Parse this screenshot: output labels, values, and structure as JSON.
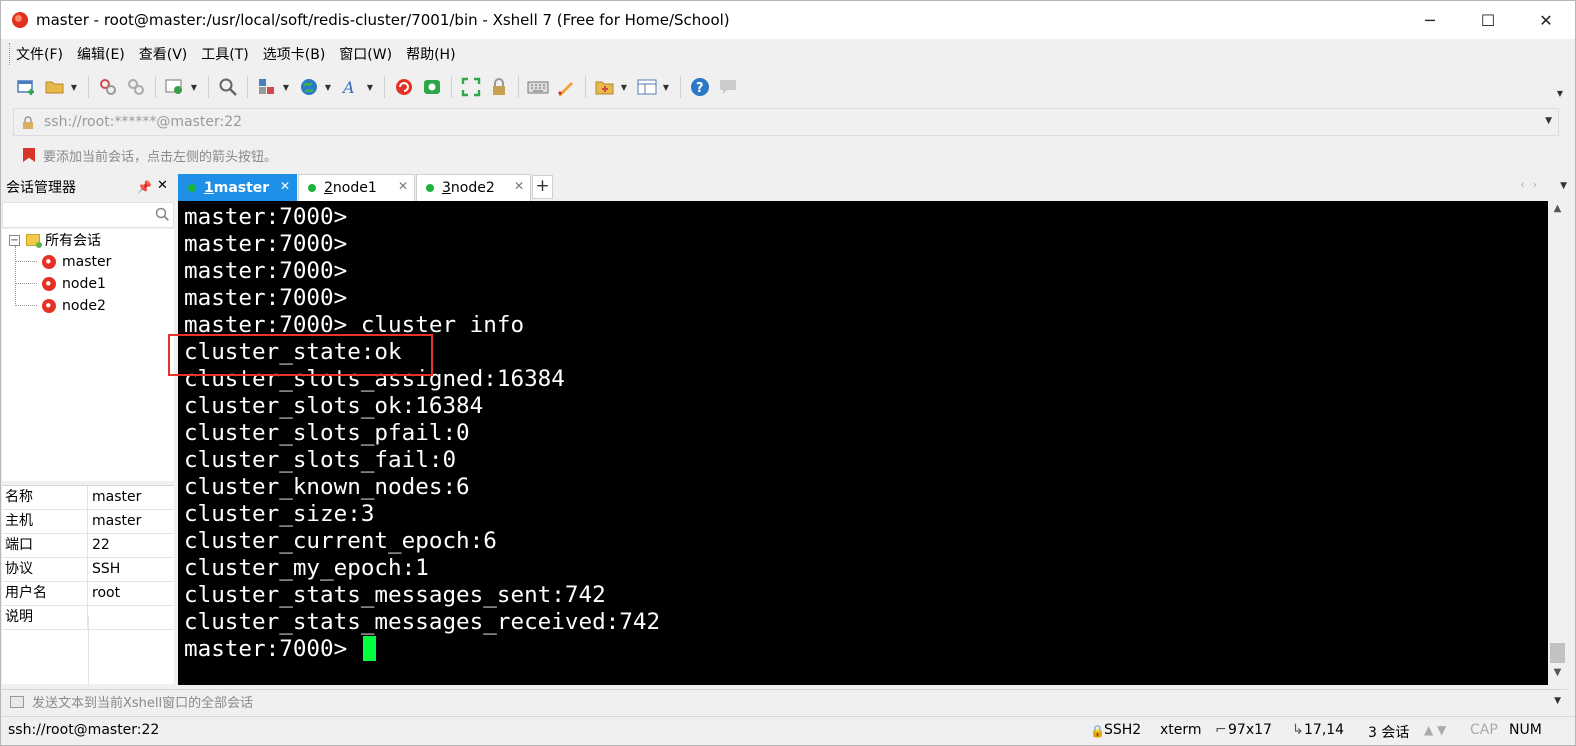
{
  "window": {
    "title": "master - root@master:/usr/local/soft/redis-cluster/7001/bin - Xshell 7 (Free for Home/School)",
    "controls": [
      "─",
      "☐",
      "✕"
    ]
  },
  "menu": [
    "文件(F)",
    "编辑(E)",
    "查看(V)",
    "工具(T)",
    "选项卡(B)",
    "窗口(W)",
    "帮助(H)"
  ],
  "address": {
    "text": "ssh://root:******@master:22"
  },
  "hint": {
    "text": "要添加当前会话，点击左侧的箭头按钮。"
  },
  "session_manager": {
    "title": "会话管理器",
    "pin_glyph": "📌",
    "close_glyph": "✕",
    "root": "所有会话",
    "root_toggle": "−",
    "sessions": [
      "master",
      "node1",
      "node2"
    ]
  },
  "properties": [
    {
      "key": "名称",
      "value": "master"
    },
    {
      "key": "主机",
      "value": "master"
    },
    {
      "key": "端口",
      "value": "22"
    },
    {
      "key": "协议",
      "value": "SSH"
    },
    {
      "key": "用户名",
      "value": "root"
    },
    {
      "key": "说明",
      "value": ""
    }
  ],
  "tabs": [
    {
      "num": "1",
      "name": " master",
      "active": true
    },
    {
      "num": "2",
      "name": " node1",
      "active": false
    },
    {
      "num": "3",
      "name": " node2",
      "active": false
    }
  ],
  "tab_add": "+",
  "tab_close": "✕",
  "tab_nav": "‹›",
  "terminal": {
    "lines": [
      "master:7000>",
      "master:7000>",
      "master:7000>",
      "master:7000>",
      "master:7000> cluster info",
      "cluster_state:ok",
      "cluster_slots_assigned:16384",
      "cluster_slots_ok:16384",
      "cluster_slots_pfail:0",
      "cluster_slots_fail:0",
      "cluster_known_nodes:6",
      "cluster_size:3",
      "cluster_current_epoch:6",
      "cluster_my_epoch:1",
      "cluster_stats_messages_sent:742",
      "cluster_stats_messages_received:742"
    ],
    "prompt": "master:7000> ",
    "cursor_color": "#00ff3c",
    "highlight_color": "#e8332a"
  },
  "send_bar": {
    "text": "发送文本到当前Xshell窗口的全部会话"
  },
  "status": {
    "connection": "ssh://root@master:22",
    "protocol": "SSH2",
    "terminal_type": "xterm",
    "size": "97x17",
    "cursor_pos": "17,14",
    "sessions": "3 会话",
    "caps": "CAP",
    "num": "NUM"
  },
  "icons": {
    "app": "xshell-app-icon",
    "toolbar": [
      "new-session-icon",
      "open-folder-icon",
      "reconnect-icon",
      "disconnect-icon",
      "properties-icon",
      "find-icon",
      "transfer-icon",
      "globe-icon",
      "font-icon",
      "xshell-icon",
      "xftp-icon",
      "fullscreen-icon",
      "lock-icon",
      "keyboard-icon",
      "script-icon",
      "compose-icon",
      "layout-icon",
      "help-icon",
      "chat-icon"
    ]
  },
  "colors": {
    "accent": "#1e90e8",
    "terminal_bg": "#000000",
    "terminal_fg": "#ffffff",
    "online_dot": "#1cb53c"
  }
}
